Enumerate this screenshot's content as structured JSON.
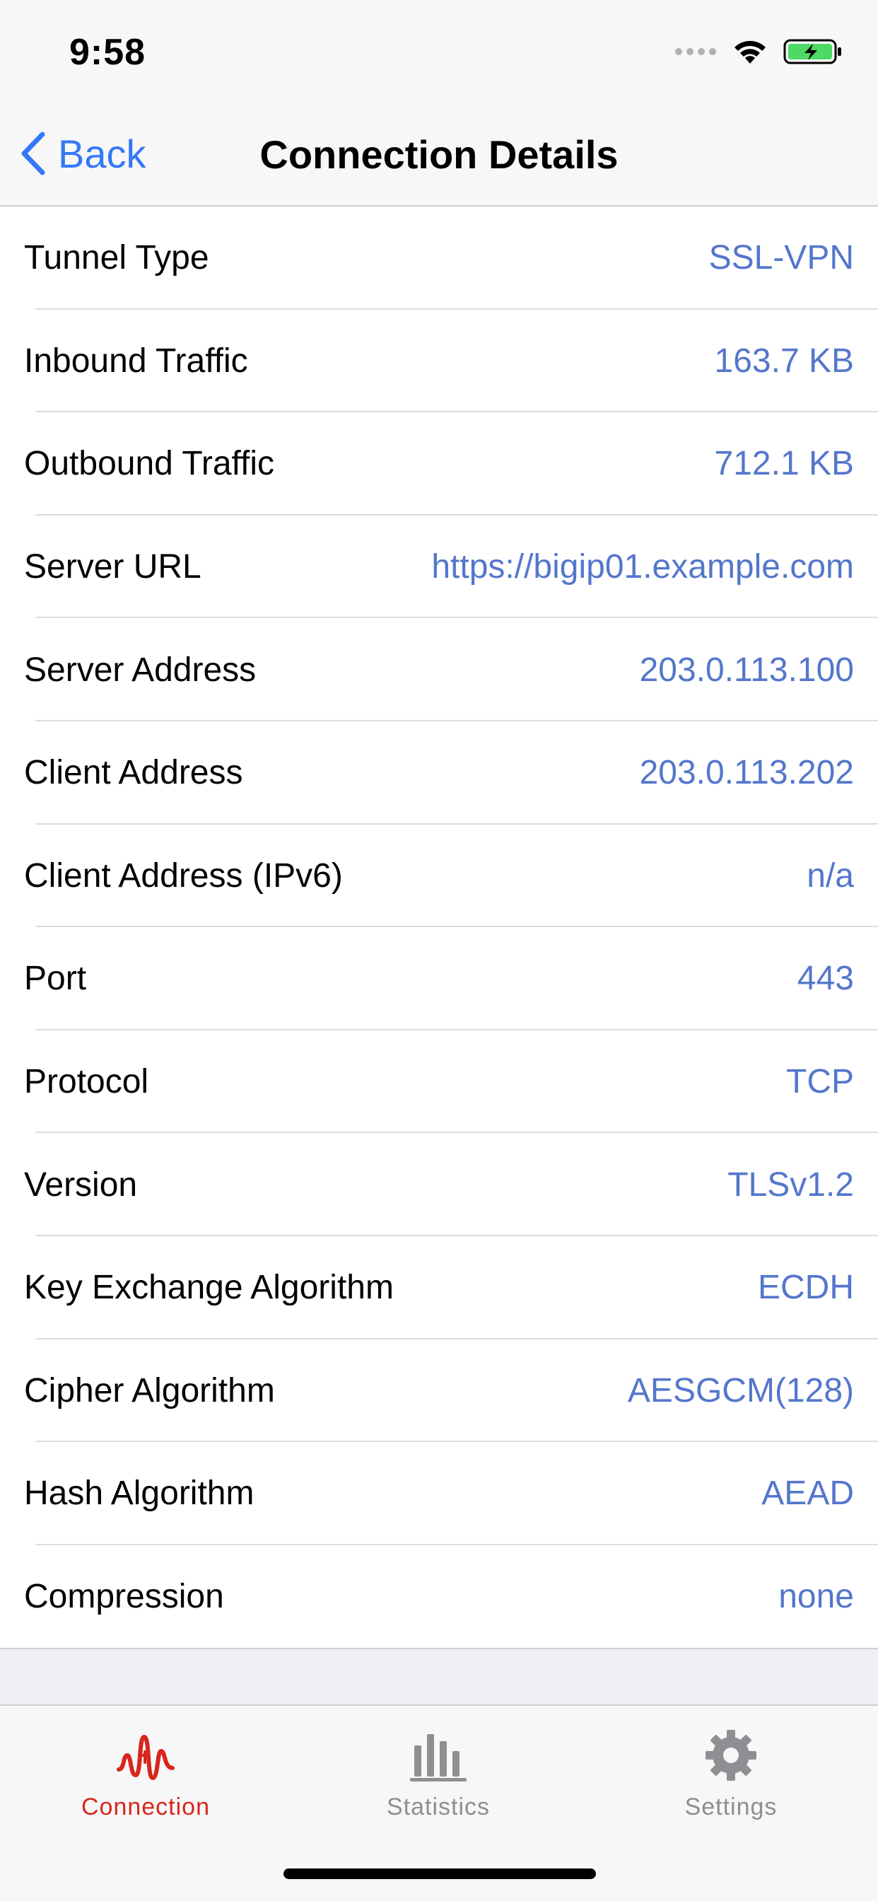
{
  "status_bar": {
    "time": "9:58"
  },
  "nav": {
    "back_label": "Back",
    "title": "Connection Details"
  },
  "details": [
    {
      "label": "Tunnel Type",
      "value": "SSL-VPN"
    },
    {
      "label": "Inbound Traffic",
      "value": "163.7 KB"
    },
    {
      "label": "Outbound Traffic",
      "value": "712.1 KB"
    },
    {
      "label": "Server URL",
      "value": "https://bigip01.example.com"
    },
    {
      "label": "Server Address",
      "value": "203.0.113.100"
    },
    {
      "label": "Client Address",
      "value": "203.0.113.202"
    },
    {
      "label": "Client Address (IPv6)",
      "value": "n/a"
    },
    {
      "label": "Port",
      "value": "443"
    },
    {
      "label": "Protocol",
      "value": "TCP"
    },
    {
      "label": "Version",
      "value": "TLSv1.2"
    },
    {
      "label": "Key Exchange Algorithm",
      "value": "ECDH"
    },
    {
      "label": "Cipher Algorithm",
      "value": "AESGCM(128)"
    },
    {
      "label": "Hash Algorithm",
      "value": "AEAD"
    },
    {
      "label": "Compression",
      "value": "none"
    }
  ],
  "tabs": [
    {
      "label": "Connection",
      "icon": "connection-wave-icon",
      "active": true
    },
    {
      "label": "Statistics",
      "icon": "bar-chart-icon",
      "active": false
    },
    {
      "label": "Settings",
      "icon": "gear-icon",
      "active": false
    }
  ],
  "colors": {
    "accent_blue": "#3478f6",
    "value_blue": "#5476cc",
    "active_tab_red": "#d8261d",
    "inactive_tab_gray": "#8e8e93",
    "battery_green": "#4cd964"
  }
}
